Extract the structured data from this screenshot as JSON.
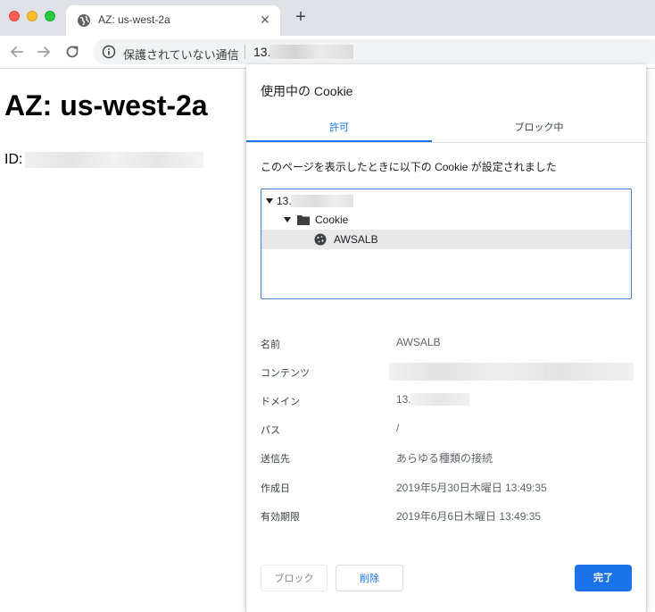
{
  "window": {
    "tab_title": "AZ: us-west-2a",
    "new_tab_label": "+",
    "tab_close_label": "✕"
  },
  "toolbar": {
    "security_text": "保護されていない通信",
    "url_prefix": "13."
  },
  "page": {
    "heading": "AZ: us-west-2a",
    "id_label": "ID:"
  },
  "dialog": {
    "title": "使用中の Cookie",
    "tabs": [
      {
        "label": "許可",
        "active": true
      },
      {
        "label": "ブロック中",
        "active": false
      }
    ],
    "description": "このページを表示したときに以下の Cookie が設定されました",
    "tree": [
      {
        "label": "13.",
        "icon": "none",
        "expanded": true
      },
      {
        "label": "Cookie",
        "icon": "folder-icon",
        "expanded": true
      },
      {
        "label": "AWSALB",
        "icon": "cookie-icon",
        "selected": true
      }
    ],
    "details": [
      {
        "label": "名前",
        "value": "AWSALB"
      },
      {
        "label": "コンテンツ",
        "value": ""
      },
      {
        "label": "ドメイン",
        "value": "13."
      },
      {
        "label": "パス",
        "value": "/"
      },
      {
        "label": "送信先",
        "value": "あらゆる種類の接続"
      },
      {
        "label": "作成日",
        "value": "2019年5月30日木曜日 13:49:35"
      },
      {
        "label": "有効期限",
        "value": "2019年6月6日木曜日 13:49:35"
      }
    ],
    "buttons": {
      "block": "ブロック",
      "delete": "削除",
      "done": "完了"
    }
  },
  "colors": {
    "accent": "#1a73e8",
    "tabstrip": "#dee1e6",
    "selected_row": "#e8e8e8"
  }
}
